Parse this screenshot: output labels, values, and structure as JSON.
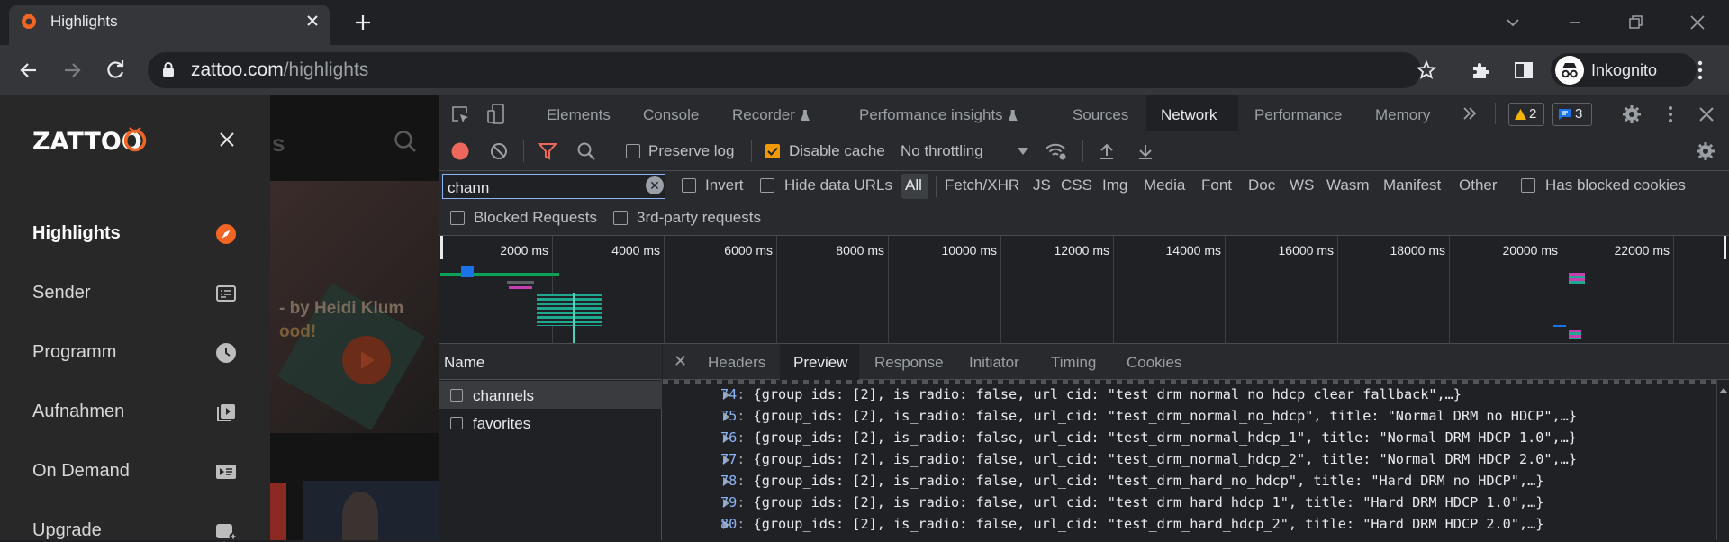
{
  "browser": {
    "tab_title": "Highlights",
    "url_host": "zattoo.com",
    "url_path": "/highlights",
    "profile_label": "Inkognito"
  },
  "zattoo": {
    "nav_items": [
      {
        "label": "Highlights",
        "icon": "compass-icon",
        "active": true
      },
      {
        "label": "Sender",
        "icon": "channel-list-icon",
        "active": false
      },
      {
        "label": "Programm",
        "icon": "clock-icon",
        "active": false
      },
      {
        "label": "Aufnahmen",
        "icon": "recordings-icon",
        "active": false
      },
      {
        "label": "On Demand",
        "icon": "on-demand-icon",
        "active": false
      },
      {
        "label": "Upgrade",
        "icon": "upgrade-icon",
        "active": false
      }
    ],
    "hero_title": "- by Heidi Klum",
    "hero_subtitle": "ood!",
    "header_fragment": "s",
    "accent_color": "#f26522"
  },
  "devtools": {
    "tabs": [
      "Elements",
      "Console",
      "Recorder",
      "Performance insights",
      "Sources",
      "Network",
      "Performance",
      "Memory"
    ],
    "active_tab": "Network",
    "warning_count": "2",
    "message_count": "3",
    "toolbar": {
      "preserve_log": "Preserve log",
      "disable_cache": "Disable cache",
      "throttling": "No throttling"
    },
    "filter": {
      "value": "chann",
      "invert": "Invert",
      "hide_data_urls": "Hide data URLs",
      "types": [
        "All",
        "Fetch/XHR",
        "JS",
        "CSS",
        "Img",
        "Media",
        "Font",
        "Doc",
        "WS",
        "Wasm",
        "Manifest",
        "Other"
      ],
      "has_blocked_cookies": "Has blocked cookies",
      "blocked_requests": "Blocked Requests",
      "third_party": "3rd-party requests"
    },
    "timeline_ticks": [
      "2000 ms",
      "4000 ms",
      "6000 ms",
      "8000 ms",
      "10000 ms",
      "12000 ms",
      "14000 ms",
      "16000 ms",
      "18000 ms",
      "20000 ms",
      "22000 ms"
    ],
    "requests": {
      "header": "Name",
      "items": [
        "channels",
        "favorites"
      ]
    },
    "detail_tabs": [
      "Headers",
      "Preview",
      "Response",
      "Initiator",
      "Timing",
      "Cookies"
    ],
    "active_detail_tab": "Preview",
    "preview_lines": [
      {
        "index": "74",
        "text": "{group_ids: [2], is_radio: false, url_cid: \"test_drm_normal_no_hdcp_clear_fallback\",…}"
      },
      {
        "index": "75",
        "text": "{group_ids: [2], is_radio: false, url_cid: \"test_drm_normal_no_hdcp\", title: \"Normal DRM no HDCP\",…}"
      },
      {
        "index": "76",
        "text": "{group_ids: [2], is_radio: false, url_cid: \"test_drm_normal_hdcp_1\", title: \"Normal DRM HDCP 1.0\",…}"
      },
      {
        "index": "77",
        "text": "{group_ids: [2], is_radio: false, url_cid: \"test_drm_normal_hdcp_2\", title: \"Normal DRM HDCP 2.0\",…}"
      },
      {
        "index": "78",
        "text": "{group_ids: [2], is_radio: false, url_cid: \"test_drm_hard_no_hdcp\", title: \"Hard DRM no HDCP\",…}"
      },
      {
        "index": "79",
        "text": "{group_ids: [2], is_radio: false, url_cid: \"test_drm_hard_hdcp_1\", title: \"Hard DRM HDCP 1.0\",…}"
      },
      {
        "index": "80",
        "text": "{group_ids: [2], is_radio: false, url_cid: \"test_drm_hard_hdcp_2\", title: \"Hard DRM HDCP 2.0\",…}"
      }
    ]
  }
}
